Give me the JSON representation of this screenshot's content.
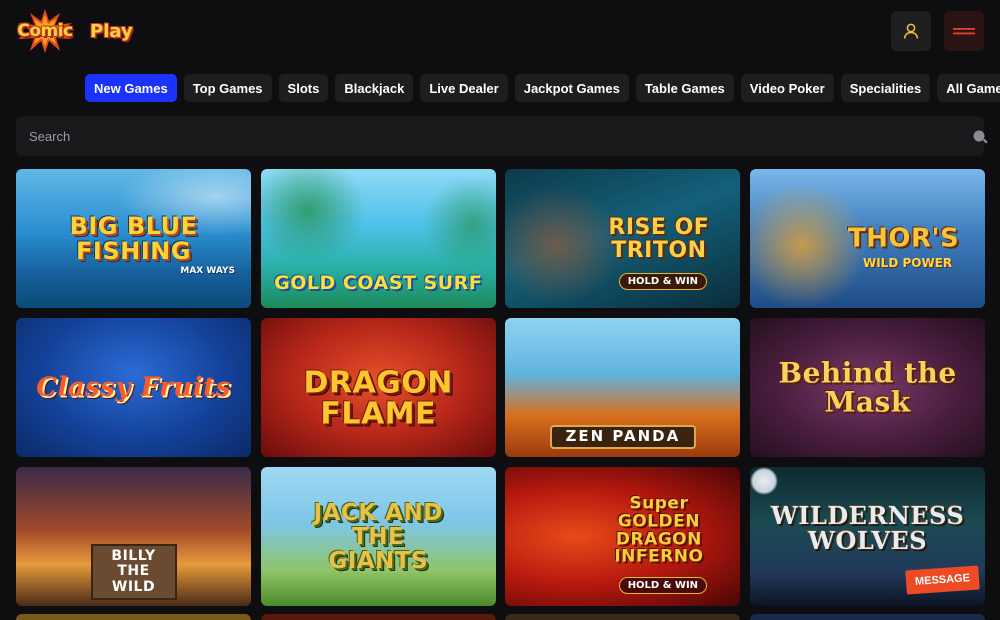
{
  "header": {
    "logo_word1": "Comic",
    "logo_word2": "Play",
    "user_icon": "user-icon",
    "menu_icon": "hamburger-menu-icon"
  },
  "tabs": [
    {
      "label": "New Games",
      "active": true
    },
    {
      "label": "Top Games",
      "active": false
    },
    {
      "label": "Slots",
      "active": false
    },
    {
      "label": "Blackjack",
      "active": false
    },
    {
      "label": "Live Dealer",
      "active": false
    },
    {
      "label": "Jackpot Games",
      "active": false
    },
    {
      "label": "Table Games",
      "active": false
    },
    {
      "label": "Video Poker",
      "active": false
    },
    {
      "label": "Specialities",
      "active": false
    },
    {
      "label": "All Games",
      "active": false
    }
  ],
  "search": {
    "placeholder": "Search",
    "icon": "search-icon"
  },
  "games": [
    {
      "title": "BIG BLUE FISHING",
      "sub": "MAX WAYS"
    },
    {
      "title": "GOLD COAST SURF",
      "sub": ""
    },
    {
      "title": "RISE OF TRITON",
      "sub": "HOLD & WIN"
    },
    {
      "title": "THOR'S",
      "sub": "WILD POWER"
    },
    {
      "title": "Classy Fruits",
      "sub": ""
    },
    {
      "title": "DRAGON FLAME",
      "sub": ""
    },
    {
      "title": "ZEN PANDA",
      "sub": ""
    },
    {
      "title": "Behind the Mask",
      "sub": ""
    },
    {
      "title": "BILLY THE WILD",
      "sub": ""
    },
    {
      "title": "JACK AND THE GIANTS",
      "sub": ""
    },
    {
      "title": "Super GOLDEN DRAGON INFERNO",
      "sub": "HOLD & WIN"
    },
    {
      "title": "WILDERNESS WOLVES",
      "sub": "",
      "badge": "MESSAGE"
    }
  ],
  "colors": {
    "background": "#0e0e10",
    "tab_active": "#1a33ff",
    "tab_inactive": "#1e1e21",
    "logo_yellow": "#ffd23a",
    "logo_red": "#c0392b",
    "message_badge": "#ee4a23"
  }
}
